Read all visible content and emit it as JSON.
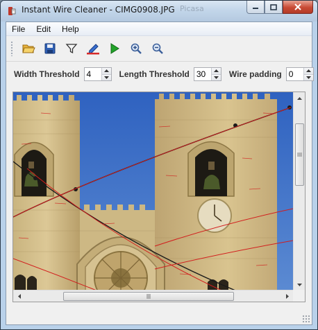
{
  "window": {
    "title": "Instant Wire Cleaner - CIMG0908.JPG",
    "background_tab_text": "Picasa"
  },
  "menu": {
    "items": [
      {
        "label": "File"
      },
      {
        "label": "Edit"
      },
      {
        "label": "Help"
      }
    ]
  },
  "toolbar": {
    "buttons": [
      {
        "icon": "open-folder-icon"
      },
      {
        "icon": "save-disk-icon"
      },
      {
        "icon": "filter-funnel-icon"
      },
      {
        "icon": "marker-pen-icon"
      },
      {
        "icon": "play-run-icon"
      },
      {
        "icon": "zoom-in-icon"
      },
      {
        "icon": "zoom-out-icon"
      }
    ]
  },
  "params": {
    "width_threshold_label": "Width Threshold",
    "width_threshold_value": "4",
    "length_threshold_label": "Length Threshold",
    "length_threshold_value": "30",
    "wire_padding_label": "Wire padding",
    "wire_padding_value": "0"
  },
  "image": {
    "subject": "cathedral-towers-with-wires",
    "detected_wire_color": "#d21c1c",
    "sky_color": "#3f6ec4"
  },
  "scrollbar": {
    "vertical_position": 0.17,
    "horizontal_position": 0.45
  }
}
